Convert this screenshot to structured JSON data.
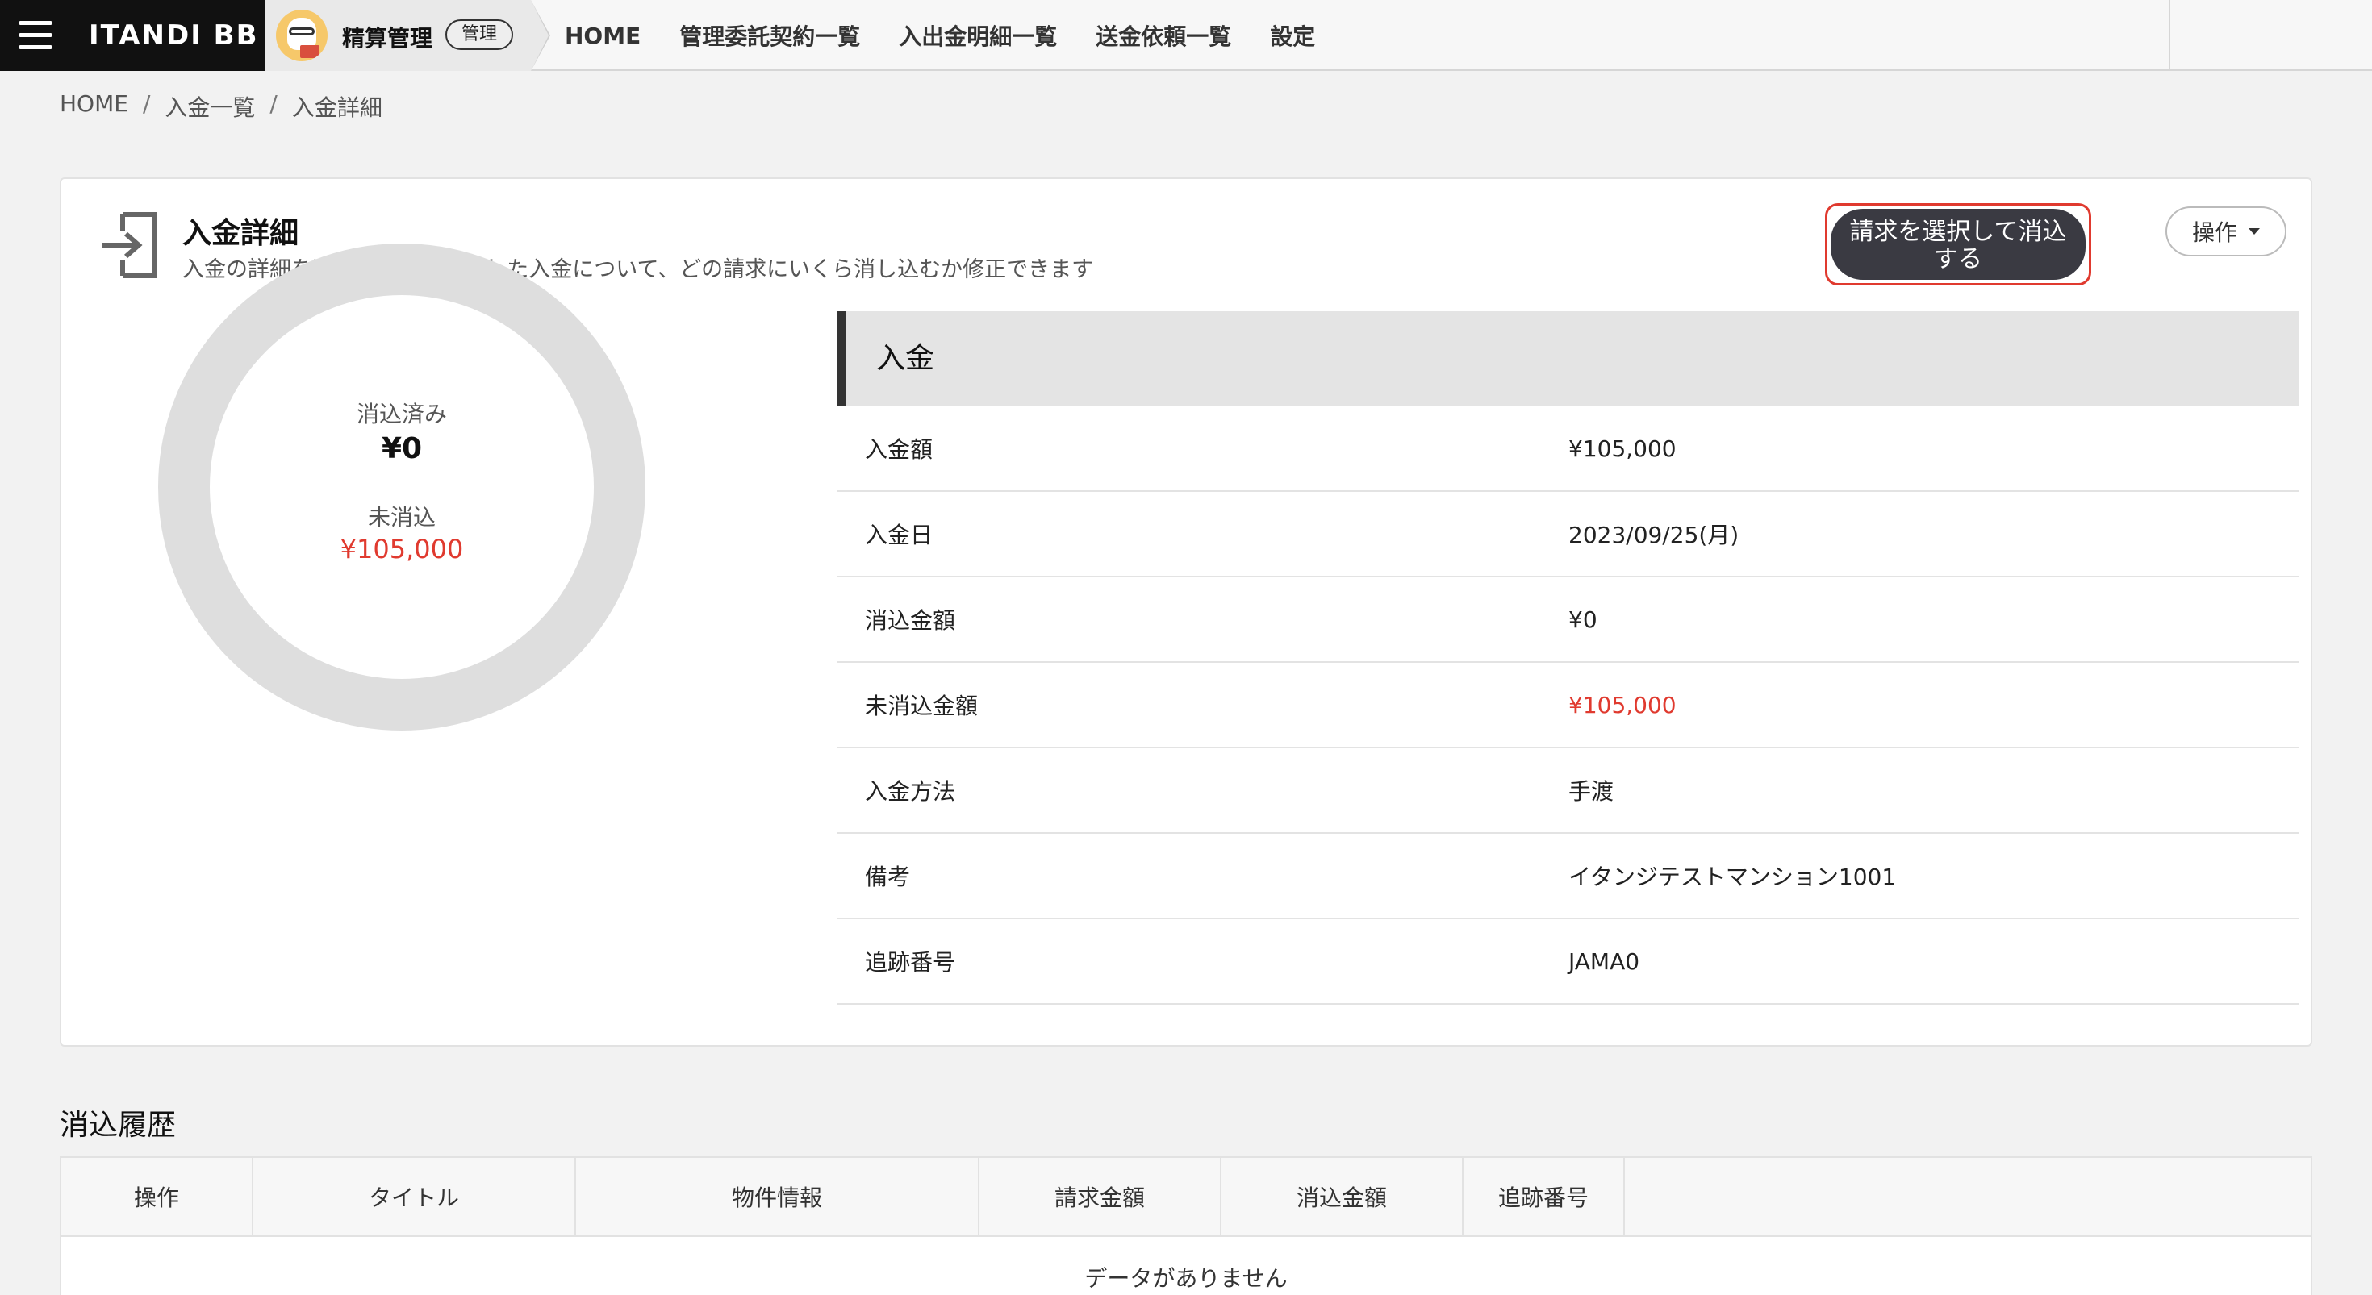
{
  "header": {
    "brand": "ITANDI BB",
    "app_name": "精算管理",
    "role": "管理",
    "nav": [
      "HOME",
      "管理委託契約一覧",
      "入出金明細一覧",
      "送金依頼一覧",
      "設定"
    ]
  },
  "breadcrumb": [
    "HOME",
    "入金一覧",
    "入金詳細"
  ],
  "page": {
    "title": "入金詳細",
    "description": "入金の詳細を確認します。選択した入金について、どの請求にいくら消し込むか修正できます",
    "primary_button": "請求を選択して消込する",
    "ops_button": "操作"
  },
  "donut": {
    "reconciled_label": "消込済み",
    "reconciled_value": "¥0",
    "unreconciled_label": "未消込",
    "unreconciled_value": "¥105,000",
    "reconciled_fraction": 0,
    "ring_color": "#dedede",
    "alert_color": "#e03a2f"
  },
  "detail": {
    "heading": "入金",
    "rows": [
      {
        "label": "入金額",
        "value": "¥105,000"
      },
      {
        "label": "入金日",
        "value": "2023/09/25(月)"
      },
      {
        "label": "消込金額",
        "value": "¥0"
      },
      {
        "label": "未消込金額",
        "value": "¥105,000"
      },
      {
        "label": "入金方法",
        "value": "手渡"
      },
      {
        "label": "備考",
        "value": "イタンジテストマンション1001"
      },
      {
        "label": "追跡番号",
        "value": "JAMA0"
      }
    ]
  },
  "history": {
    "title": "消込履歴",
    "columns": [
      "操作",
      "タイトル",
      "物件情報",
      "請求金額",
      "消込金額",
      "追跡番号"
    ],
    "empty_text": "データがありません"
  }
}
